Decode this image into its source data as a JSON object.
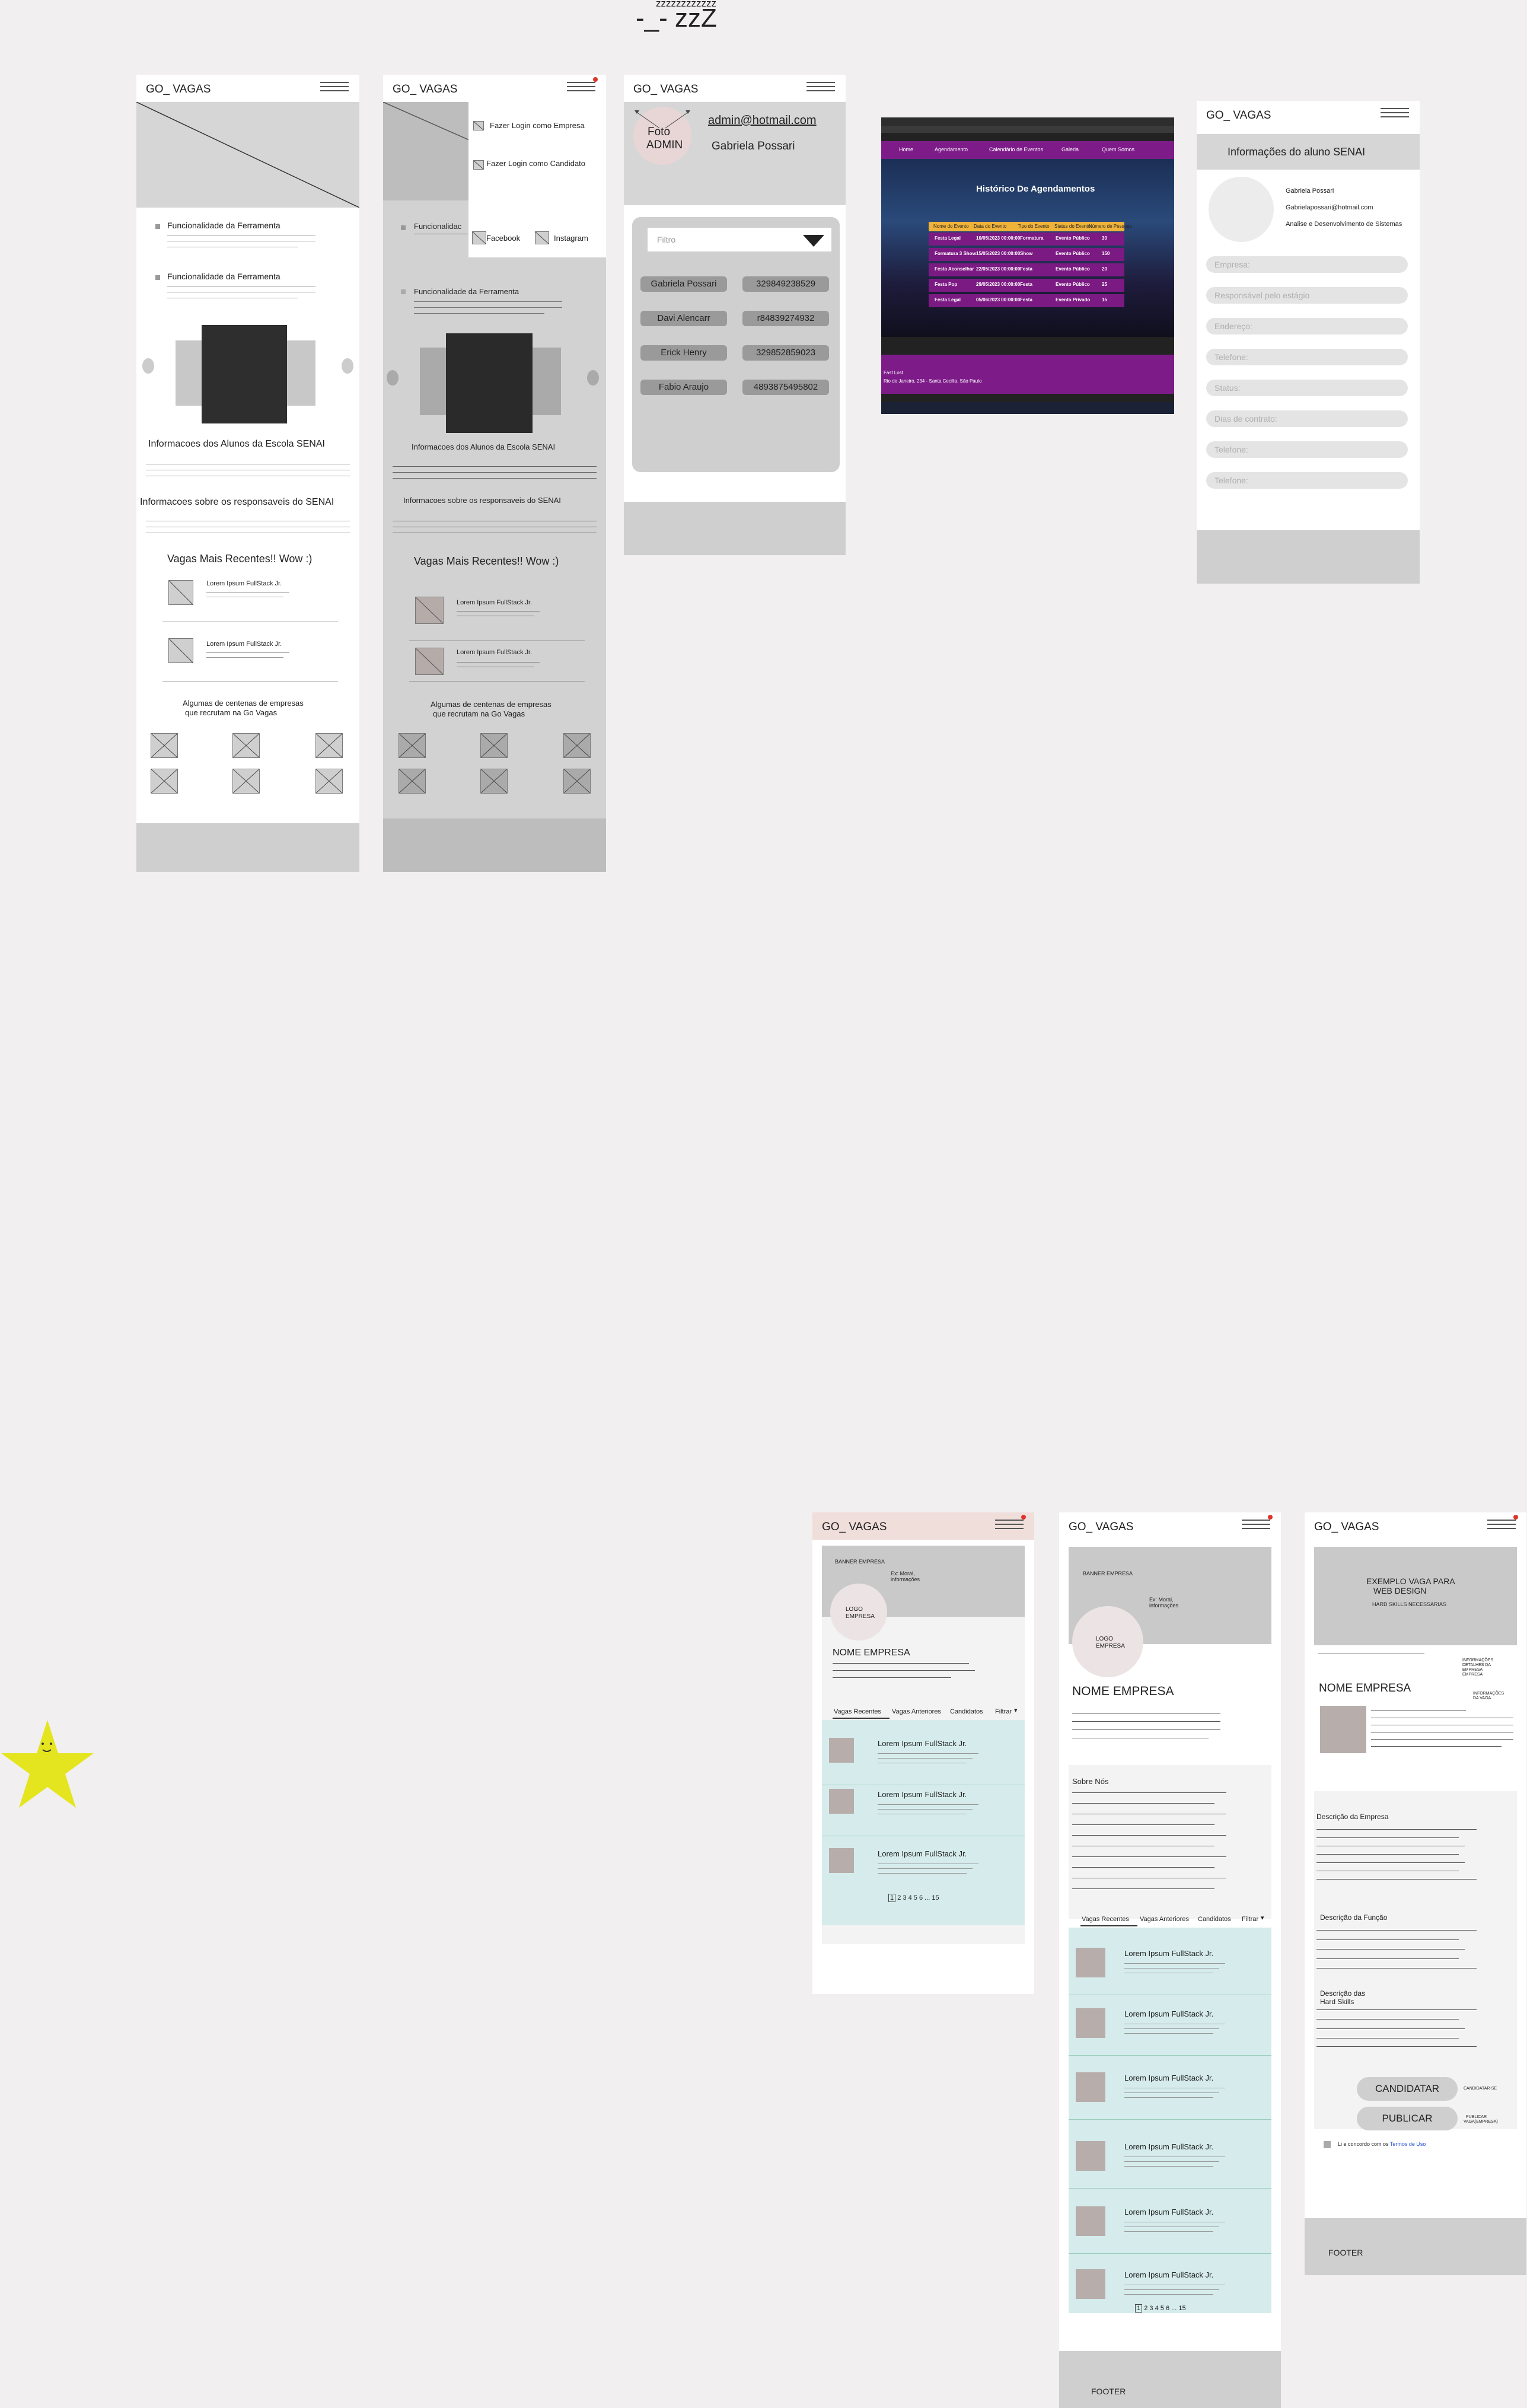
{
  "canvas": {
    "title": "-_- zzZ",
    "subtitle": "zzzzzzzzzzzz",
    "star_color": "#e4e51f"
  },
  "brand": "GO_ VAGAS",
  "screen_home": {
    "features": [
      "Funcionalidade da Ferramenta",
      "Funcionalidade da Ferramenta"
    ],
    "students_title": "Informacoes dos Alunos da Escola SENAI",
    "responsibles_title": "Informacoes  sobre os responsaveis do SENAI",
    "recent_title": "Vagas Mais Recentes!! Wow :)",
    "jobs": [
      "Lorem Ipsum FullStack Jr.",
      "Lorem Ipsum FullStack Jr."
    ],
    "companies_line1": "Algumas de centenas de empresas",
    "companies_line2": "que recrutam na Go Vagas"
  },
  "screen_menu": {
    "menu_items": [
      "Fazer Login como Empresa",
      "Fazer Login como  Candidato"
    ],
    "social": [
      "Facebook",
      "Instagram"
    ],
    "feature": "Funcionalidade da Ferramenta",
    "feature_cut": "Funcionalidac",
    "students_title": "Informacoes dos Alunos da Escola SENAI",
    "responsibles_title": "Informacoes  sobre os responsaveis do SENAI",
    "recent_title": "Vagas Mais Recentes!! Wow :)",
    "jobs": [
      "Lorem Ipsum FullStack Jr.",
      "Lorem Ipsum FullStack Jr."
    ],
    "companies_line1": "Algumas de centenas de empresas",
    "companies_line2": "que recrutam na Go Vagas"
  },
  "screen_admin": {
    "photo_label_1": "Foto",
    "photo_label_2": "ADMIN",
    "email": "admin@hotmail.com",
    "name": "Gabriela Possari",
    "filter_placeholder": "Filtro",
    "rows": [
      {
        "name": "Gabriela Possari",
        "phone": "329849238529"
      },
      {
        "name": "Davi Alencarr",
        "phone": "r84839274932"
      },
      {
        "name": "Erick Henry",
        "phone": "329852859023"
      },
      {
        "name": "Fabio Araujo",
        "phone": "4893875495802"
      }
    ]
  },
  "screen_screenshot": {
    "nav": [
      "Home",
      "Agendamento",
      "Calendário de Eventos",
      "Galeria",
      "Quem Somos"
    ],
    "title": "Histórico De Agendamentos",
    "headers": [
      "Nome do Evento",
      "Data do Evento",
      "Tipo do Evento",
      "Status do Evento",
      "Número de Pessoas"
    ],
    "rows": [
      [
        "Festa Legal",
        "10/05/2023 00:00:00",
        "Formatura",
        "Evento Público",
        "30"
      ],
      [
        "Formatura 3 Show",
        "15/05/2023 00:00:00",
        "Show",
        "Evento Público",
        "150"
      ],
      [
        "Festa Aconselhar",
        "22/05/2023 00:00:00",
        "Festa",
        "Evento Público",
        "20"
      ],
      [
        "Festa Pop",
        "29/05/2023 00:00:00",
        "Festa",
        "Evento Público",
        "25"
      ],
      [
        "Festa Legal",
        "05/06/2023 00:00:00",
        "Festa",
        "Evento Privado",
        "15"
      ]
    ],
    "footer_1": "Fast Lost",
    "footer_2": "Rio de Janeiro, 234 - Santa Cecília, São Paulo"
  },
  "screen_student": {
    "title": "Informações do aluno SENAI",
    "name": "Gabriela Possari",
    "email": "Gabrielapossari@hotmail.com",
    "course": "Analise e Desenvolvimento de Sistemas",
    "fields": [
      "Empresa:",
      "Responsável pelo estágio",
      "Endereço:",
      "Telefone:",
      "Status:",
      "Dias de contrato:",
      "Telefone:",
      "Telefone:"
    ]
  },
  "screen_company1": {
    "banner": "BANNER EMPRESA",
    "banner_info_1": "Ex: Moral,",
    "banner_info_2": "informações",
    "logo_1": "LOGO",
    "logo_2": "EMPRESA",
    "name": "NOME EMPRESA",
    "tabs": [
      "Vagas Recentes",
      "Vagas Anteriores",
      "Candidatos",
      "Filtrar"
    ],
    "jobs": [
      "Lorem Ipsum FullStack Jr.",
      "Lorem Ipsum FullStack Jr.",
      "Lorem Ipsum FullStack Jr."
    ],
    "pagination": [
      "1",
      "2",
      "3",
      "4",
      "5",
      "6",
      "...",
      "15"
    ]
  },
  "screen_company2": {
    "banner": "BANNER EMPRESA",
    "banner_info_1": "Ex: Moral,",
    "banner_info_2": "informações",
    "logo_1": "LOGO",
    "logo_2": "EMPRESA",
    "name": "NOME EMPRESA",
    "about": "Sobre Nós",
    "tabs": [
      "Vagas Recentes",
      "Vagas Anteriores",
      "Candidatos",
      "Filtrar"
    ],
    "jobs": [
      "Lorem Ipsum FullStack Jr.",
      "Lorem Ipsum FullStack Jr.",
      "Lorem Ipsum FullStack Jr.",
      "Lorem Ipsum FullStack Jr.",
      "Lorem Ipsum FullStack Jr.",
      "Lorem Ipsum FullStack Jr."
    ],
    "pagination": [
      "1",
      "2",
      "3",
      "4",
      "5",
      "6",
      "...",
      "15"
    ],
    "footer": "FOOTER"
  },
  "screen_job": {
    "banner_1": "EXEMPLO VAGA PARA",
    "banner_2": "WEB DESIGN",
    "banner_3": "HARD SKILLS NECESSARIAS",
    "info_1": "INFORMAÇÕES",
    "info_2": "DETALHES DA",
    "info_3": "EMPRESA",
    "info_4": "EMPRESA",
    "name": "NOME EMPRESA",
    "vaga_info_1": "INFORMAÇÕES",
    "vaga_info_2": "DA VAGA",
    "desc_company": "Descrição da Empresa",
    "desc_function": "Descrição da Função",
    "desc_hard_1": "Descrição das",
    "desc_hard_2": "Hard Skills",
    "apply": "CANDIDATAR",
    "apply_note": "CANDIDATAR-SE",
    "publish": "PUBLICAR",
    "publish_note_1": "PUBLICAR",
    "publish_note_2": "VAGA(EMPRESA)",
    "terms_pre": "Li e concordo com os",
    "terms_link": "Termos de Uso",
    "footer": "FOOTER"
  }
}
